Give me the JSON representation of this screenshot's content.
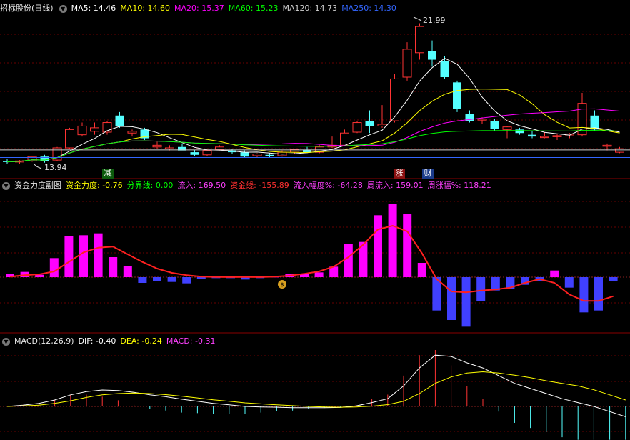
{
  "colors": {
    "up": "#ff3333",
    "down": "#54ffff",
    "ma5": "#ffffff",
    "ma10": "#ffff00",
    "ma20": "#ff00ff",
    "ma60": "#00ff00",
    "ma120": "#cfcfcf",
    "ma250": "#3366ff",
    "grid": "#7a0000",
    "pos": "#ff00ff",
    "neg": "#4040ff",
    "line": "#ff2020"
  },
  "main_header": {
    "title": "招标股份(日线)",
    "ma5": "MA5: 14.46",
    "ma10": "MA10: 14.60",
    "ma20": "MA20: 15.37",
    "ma60": "MA60: 15.23",
    "ma120": "MA120: 14.73",
    "ma250": "MA250: 14.30"
  },
  "main_tags": {
    "high": "21.99",
    "low": "13.94",
    "jian": "减",
    "zhang": "涨",
    "cai": "财"
  },
  "sub1_header": {
    "title": "资金力度副图",
    "f1": "资金力度: -0.76",
    "f2": "分界线: 0.00",
    "f3": "流入: 169.50",
    "f4": "资金线: -155.89",
    "f5": "流入幅度%: -64.28",
    "f6": "周流入: 159.01",
    "f7": "周涨幅%: 118.21"
  },
  "sub2_header": {
    "title": "MACD(12,26,9)",
    "dif": "DIF: -0.40",
    "dea": "DEA: -0.24",
    "macd": "MACD: -0.31"
  },
  "chart_data": [
    {
      "type": "candlestick",
      "title": "招标股份(日线)",
      "ylim": [
        13.5,
        22.5
      ],
      "ohlc": [
        [
          14.1,
          14.2,
          13.94,
          14.05
        ],
        [
          14.05,
          14.15,
          13.95,
          14.1
        ],
        [
          14.1,
          14.4,
          14.05,
          14.35
        ],
        [
          14.35,
          14.45,
          14.0,
          14.1
        ],
        [
          14.15,
          14.9,
          14.1,
          14.85
        ],
        [
          14.85,
          16.0,
          14.8,
          15.9
        ],
        [
          15.6,
          16.3,
          15.5,
          16.1
        ],
        [
          15.8,
          16.3,
          15.6,
          16.0
        ],
        [
          15.75,
          16.4,
          15.6,
          16.3
        ],
        [
          16.7,
          16.9,
          16.0,
          16.1
        ],
        [
          15.7,
          15.9,
          15.5,
          15.8
        ],
        [
          15.9,
          16.0,
          15.3,
          15.4
        ],
        [
          14.9,
          15.2,
          14.8,
          15.0
        ],
        [
          14.8,
          15.0,
          14.7,
          14.85
        ],
        [
          14.9,
          15.1,
          14.8,
          14.7
        ],
        [
          14.6,
          14.75,
          14.4,
          14.45
        ],
        [
          14.45,
          14.8,
          14.4,
          14.7
        ],
        [
          14.75,
          15.0,
          14.7,
          14.9
        ],
        [
          14.7,
          14.8,
          14.5,
          14.6
        ],
        [
          14.6,
          14.7,
          14.3,
          14.35
        ],
        [
          14.4,
          14.55,
          14.3,
          14.5
        ],
        [
          14.45,
          14.55,
          14.3,
          14.4
        ],
        [
          14.4,
          14.7,
          14.35,
          14.6
        ],
        [
          14.6,
          14.8,
          14.5,
          14.75
        ],
        [
          14.75,
          14.9,
          14.55,
          14.6
        ],
        [
          14.6,
          15.0,
          14.55,
          14.9
        ],
        [
          14.9,
          15.5,
          14.85,
          15.0
        ],
        [
          15.0,
          15.9,
          14.95,
          15.7
        ],
        [
          15.75,
          16.4,
          15.7,
          16.3
        ],
        [
          16.4,
          17.0,
          15.7,
          16.1
        ],
        [
          16.1,
          17.3,
          16.0,
          16.2
        ],
        [
          16.4,
          19.1,
          16.3,
          18.8
        ],
        [
          18.9,
          20.9,
          18.7,
          20.5
        ],
        [
          20.3,
          21.99,
          19.9,
          21.8
        ],
        [
          20.4,
          21.0,
          19.5,
          19.9
        ],
        [
          19.8,
          20.1,
          18.8,
          18.9
        ],
        [
          18.6,
          18.7,
          16.9,
          17.1
        ],
        [
          16.8,
          17.0,
          16.3,
          16.4
        ],
        [
          16.45,
          16.6,
          16.2,
          16.5
        ],
        [
          16.4,
          16.5,
          15.8,
          15.95
        ],
        [
          15.9,
          16.1,
          15.4,
          16.05
        ],
        [
          15.9,
          16.0,
          15.6,
          15.7
        ],
        [
          15.6,
          15.8,
          15.4,
          15.5
        ],
        [
          15.5,
          15.75,
          15.4,
          15.5
        ],
        [
          15.5,
          15.65,
          15.3,
          15.55
        ],
        [
          15.6,
          15.7,
          15.4,
          15.65
        ],
        [
          15.6,
          18.0,
          15.5,
          17.4
        ],
        [
          16.7,
          17.0,
          15.8,
          15.9
        ],
        [
          15.0,
          15.1,
          14.7,
          15.0
        ],
        [
          14.6,
          14.9,
          14.55,
          14.8
        ]
      ]
    },
    {
      "type": "bar",
      "title": "资金力度副图",
      "ylim": [
        -5.5,
        9
      ],
      "values": [
        0.35,
        0.55,
        0.25,
        2.0,
        4.3,
        4.4,
        4.6,
        2.1,
        1.2,
        -0.6,
        -0.4,
        -0.5,
        -0.65,
        -0.2,
        -0.1,
        -0.1,
        -0.25,
        -0.1,
        0.05,
        0.3,
        0.3,
        0.5,
        1.1,
        3.5,
        3.7,
        6.5,
        7.7,
        6.6,
        1.5,
        -3.5,
        -4.5,
        -5.2,
        -2.5,
        -1.4,
        -1.2,
        -0.8,
        -0.45,
        0.7,
        -1.1,
        -3.7,
        -3.5,
        -0.4
      ],
      "line": [
        0.05,
        0.2,
        0.3,
        0.6,
        1.6,
        2.6,
        3.1,
        3.2,
        2.4,
        1.6,
        0.9,
        0.45,
        0.2,
        0.05,
        0.02,
        0.01,
        0.02,
        0.01,
        0.05,
        0.15,
        0.35,
        0.6,
        1.1,
        2.1,
        3.4,
        5.0,
        5.4,
        4.8,
        2.5,
        -0.2,
        -1.5,
        -1.6,
        -1.4,
        -1.3,
        -1.1,
        -0.6,
        -0.2,
        -0.6,
        -1.8,
        -2.5,
        -2.5,
        -2.0
      ]
    },
    {
      "type": "line",
      "title": "MACD(12,26,9)",
      "ylim": [
        -1.3,
        2.2
      ],
      "series": [
        {
          "name": "DIF",
          "values": [
            0.0,
            0.05,
            0.12,
            0.25,
            0.45,
            0.58,
            0.64,
            0.62,
            0.55,
            0.45,
            0.38,
            0.28,
            0.2,
            0.12,
            0.06,
            0.0,
            -0.02,
            -0.03,
            -0.05,
            -0.05,
            -0.05,
            -0.04,
            0.02,
            0.15,
            0.3,
            0.8,
            1.5,
            2.0,
            1.95,
            1.7,
            1.5,
            1.2,
            0.9,
            0.7,
            0.5,
            0.3,
            0.15,
            0.0,
            -0.2,
            -0.4
          ]
        },
        {
          "name": "DEA",
          "values": [
            0.0,
            0.02,
            0.05,
            0.12,
            0.22,
            0.35,
            0.45,
            0.5,
            0.52,
            0.5,
            0.46,
            0.4,
            0.33,
            0.26,
            0.2,
            0.14,
            0.1,
            0.06,
            0.03,
            0.0,
            -0.02,
            -0.03,
            -0.02,
            0.01,
            0.07,
            0.2,
            0.5,
            0.9,
            1.15,
            1.3,
            1.35,
            1.3,
            1.22,
            1.12,
            1.0,
            0.9,
            0.8,
            0.65,
            0.45,
            0.25
          ]
        }
      ]
    }
  ]
}
